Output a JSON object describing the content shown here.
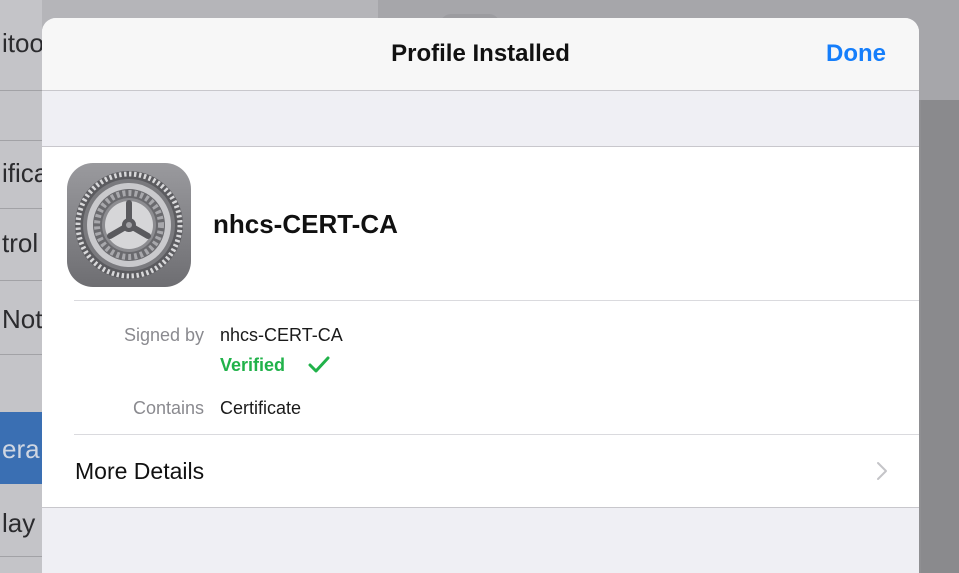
{
  "background": {
    "rows": [
      {
        "text": "itoo",
        "top": 0
      },
      {
        "text": "ifica",
        "top": 0
      },
      {
        "text": "trol",
        "top": 0
      },
      {
        "text": "Not",
        "top": 0
      },
      {
        "text": "era",
        "top": 0
      },
      {
        "text": "lay",
        "top": 0
      }
    ]
  },
  "sheet": {
    "title": "Profile Installed",
    "done_label": "Done",
    "profile": {
      "name": "nhcs-CERT-CA",
      "icon": "settings-gear-icon"
    },
    "details": {
      "signed_by_label": "Signed by",
      "signed_by_value": "nhcs-CERT-CA",
      "verified_label": "Verified",
      "contains_label": "Contains",
      "contains_value": "Certificate"
    },
    "more_details_label": "More Details"
  },
  "colors": {
    "accent": "#157efb",
    "verified": "#21b24a",
    "sheet_background": "#efeff4",
    "selected_row": "#3a6fb3"
  }
}
